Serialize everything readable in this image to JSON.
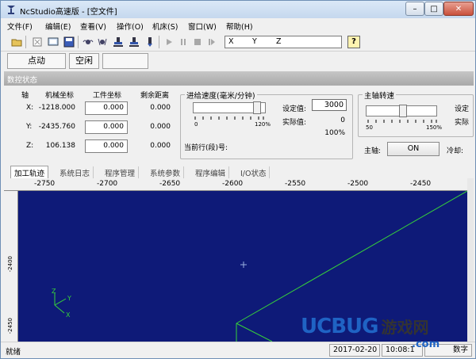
{
  "window": {
    "title": "NcStudio高速版 - [空文件]",
    "minimize": "–",
    "maximize": "□",
    "close": "✕"
  },
  "menu": [
    "文件(F)",
    "编辑(E)",
    "查看(V)",
    "操作(O)",
    "机床(S)",
    "窗口(W)",
    "帮助(H)"
  ],
  "toolbar": {
    "icons": [
      "open-icon",
      "cut-icon",
      "view-icon",
      "save-icon",
      "spindle-icon",
      "spindle-alt-icon",
      "clamp-icon",
      "clamp-alt-icon",
      "tool-icon",
      "play-icon",
      "pause-icon",
      "stop-icon",
      "step-icon",
      "step-alt-icon"
    ],
    "coord_labels": {
      "x": "X",
      "y": "Y",
      "z": "Z"
    },
    "help": "?"
  },
  "mode": {
    "jog": "点动",
    "status": "空闲",
    "empty": ""
  },
  "panel": {
    "title": "数控状态",
    "axis_header": "轴",
    "machine_header": "机械坐标",
    "work_header": "工件坐标",
    "remain_header": "剩余距离",
    "axes": [
      {
        "name": "X:",
        "machine": "-1218.000",
        "work": "0.000",
        "remain": "0.000"
      },
      {
        "name": "Y:",
        "machine": "-2435.760",
        "work": "0.000",
        "remain": "0.000"
      },
      {
        "name": "Z:",
        "machine": "106.138",
        "work": "0.000",
        "remain": "0.000"
      }
    ],
    "feed": {
      "title": "进给速度(毫米/分钟)",
      "scale_min": "0",
      "scale_max": "120%",
      "set_label": "设定值:",
      "set_value": "3000",
      "actual_label": "实际值:",
      "actual_value": "0",
      "percent": "100%",
      "current_line": "当前行(段)号:"
    },
    "spindle": {
      "title": "主轴转速",
      "scale_min": "50",
      "scale_max": "150%",
      "set_label": "设定",
      "actual_label": "实际",
      "spindle_label": "主轴:",
      "spindle_button": "ON",
      "coolant_label": "冷却:"
    }
  },
  "tabs": [
    "加工轨迹",
    "系统日志",
    "程序管理",
    "系统参数",
    "程序编辑",
    "I/O状态"
  ],
  "ruler": {
    "top": [
      "-2750",
      "-2700",
      "-2650",
      "-2600",
      "-2550",
      "-2500",
      "-2450"
    ],
    "left": [
      "-2400",
      "-2450"
    ]
  },
  "axis_indicator": {
    "z": "Z",
    "y": "Y",
    "x": "X"
  },
  "status": {
    "ready": "就绪",
    "date": "2017-02-20",
    "time": "10:08:1",
    "numeric": "数字"
  },
  "watermark": {
    "brand_uc": "UC",
    "brand_bug": "BUG",
    "cn": "游戏网",
    "com": ".com"
  },
  "colors": {
    "canvas": "#0e1a78",
    "toolpath": "#36d13a",
    "watermark_blue": "#1f63c4"
  }
}
